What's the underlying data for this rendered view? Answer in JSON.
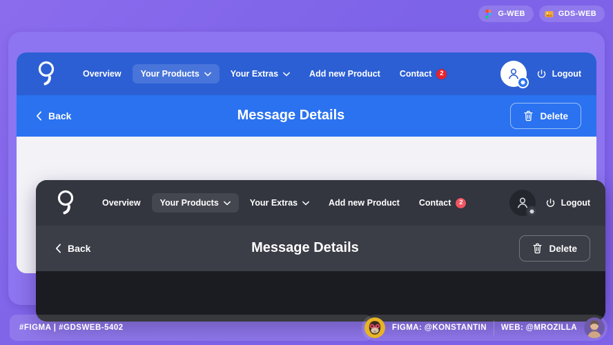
{
  "top_badges": [
    {
      "label": "G-WEB",
      "icon": "figma-icon"
    },
    {
      "label": "GDS-WEB",
      "icon": "image-icon"
    }
  ],
  "light_panel": {
    "logo_name": "brand-logo",
    "nav": [
      {
        "label": "Overview",
        "active": false,
        "caret": false,
        "badge": null
      },
      {
        "label": "Your Products",
        "active": true,
        "caret": true,
        "badge": null
      },
      {
        "label": "Your Extras",
        "active": false,
        "caret": true,
        "badge": null
      },
      {
        "label": "Add new Product",
        "active": false,
        "caret": false,
        "badge": null
      },
      {
        "label": "Contact",
        "active": false,
        "caret": false,
        "badge": "2"
      }
    ],
    "logout_label": "Logout",
    "back_label": "Back",
    "title": "Message Details",
    "delete_label": "Delete"
  },
  "dark_panel": {
    "logo_name": "brand-logo",
    "nav": [
      {
        "label": "Overview",
        "active": false,
        "caret": false,
        "badge": null
      },
      {
        "label": "Your Products",
        "active": true,
        "caret": true,
        "badge": null
      },
      {
        "label": "Your Extras",
        "active": false,
        "caret": true,
        "badge": null
      },
      {
        "label": "Add new Product",
        "active": false,
        "caret": false,
        "badge": null
      },
      {
        "label": "Contact",
        "active": false,
        "caret": false,
        "badge": "2"
      }
    ],
    "logout_label": "Logout",
    "back_label": "Back",
    "title": "Message Details",
    "delete_label": "Delete"
  },
  "footer": {
    "ticket": "#FIGMA | #GDSWEB-5402",
    "figma_credit": "FIGMA: @KONSTANTIN",
    "web_credit": "WEB: @MROZILLA"
  },
  "colors": {
    "page_bg": "#8b6ced",
    "card_bg": "#8d74f0",
    "blue_nav": "#2c5fd4",
    "blue_sub": "#2a72f0",
    "light_body": "#f3f3f7",
    "dark_nav": "#33353f",
    "dark_sub": "#3b3d47",
    "dark_body": "#1b1c21",
    "badge_red": "#e8222c",
    "badge_red_dark": "#f0555f"
  }
}
